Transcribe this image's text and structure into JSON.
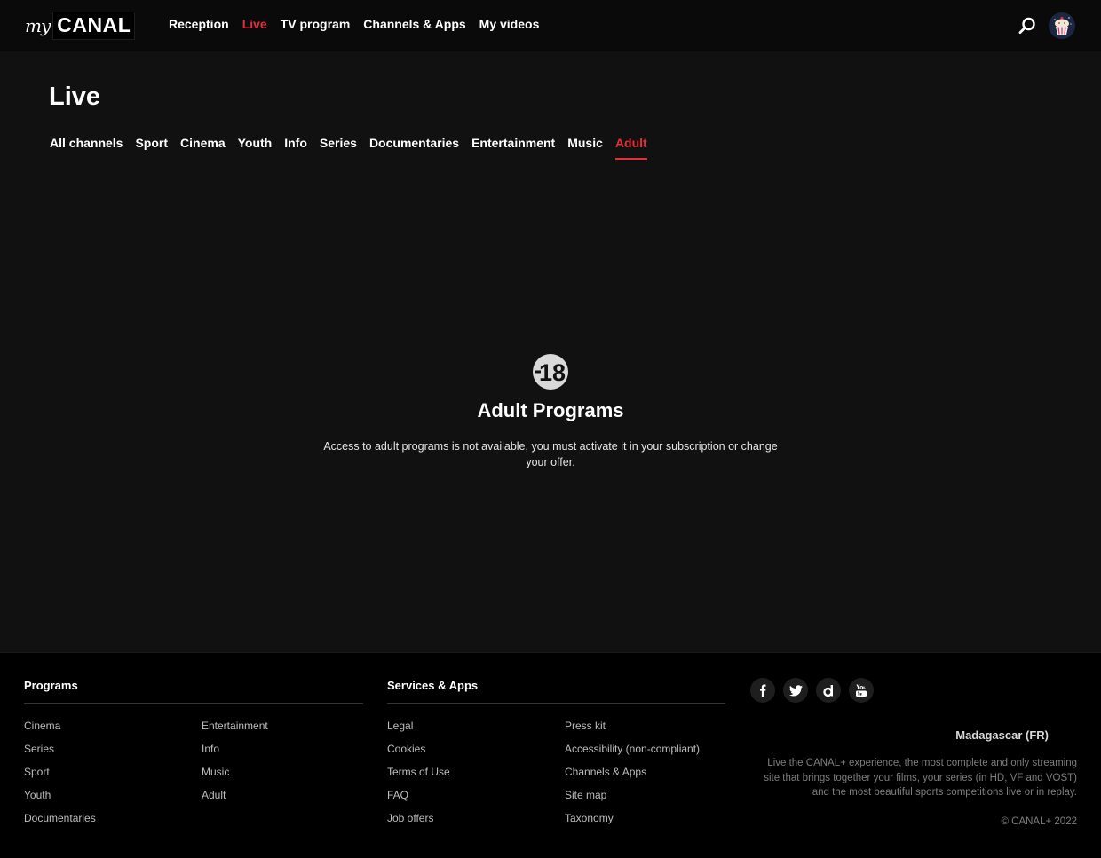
{
  "header": {
    "logo": {
      "prefix": "my",
      "brand": "CANAL"
    },
    "nav": [
      {
        "label": "Reception",
        "active": false
      },
      {
        "label": "Live",
        "active": true
      },
      {
        "label": "TV program",
        "active": false
      },
      {
        "label": "Channels & Apps",
        "active": false
      },
      {
        "label": "My videos",
        "active": false
      }
    ],
    "search_icon": "search-icon",
    "avatar_icon": "avatar-cupcake-icon"
  },
  "page": {
    "title": "Live",
    "tabs": [
      {
        "label": "All channels",
        "active": false
      },
      {
        "label": "Sport",
        "active": false
      },
      {
        "label": "Cinema",
        "active": false
      },
      {
        "label": "Youth",
        "active": false
      },
      {
        "label": "Info",
        "active": false
      },
      {
        "label": "Series",
        "active": false
      },
      {
        "label": "Documentaries",
        "active": false
      },
      {
        "label": "Entertainment",
        "active": false
      },
      {
        "label": "Music",
        "active": false
      },
      {
        "label": "Adult",
        "active": true
      }
    ]
  },
  "message": {
    "badge": "18",
    "title": "Adult Programs",
    "text": "Access to adult programs is not available, you must activate it in your subscription or change your offer."
  },
  "footer": {
    "programs": {
      "title": "Programs",
      "col1": [
        "Cinema",
        "Series",
        "Sport",
        "Youth",
        "Documentaries"
      ],
      "col2": [
        "Entertainment",
        "Info",
        "Music",
        "Adult"
      ]
    },
    "services": {
      "title": "Services & Apps",
      "col1": [
        "Legal",
        "Cookies",
        "Terms of Use",
        "FAQ",
        "Job offers"
      ],
      "col2": [
        "Press kit",
        "Accessibility (non-compliant)",
        "Channels & Apps",
        "Site map",
        "Taxonomy"
      ]
    },
    "socials": [
      "facebook-icon",
      "twitter-icon",
      "dailymotion-icon",
      "youtube-icon"
    ],
    "country": "Madagascar (FR)",
    "description": "Live the CANAL+ experience, the most complete and only streaming site that brings together your films, your series (in HD, VF and VOST) and the most beautiful sports competitions live or in replay.",
    "copyright": "© CANAL+ 2022"
  },
  "colors": {
    "accent": "#e52d3b",
    "background": "#111111",
    "footer_bg": "#000000"
  }
}
